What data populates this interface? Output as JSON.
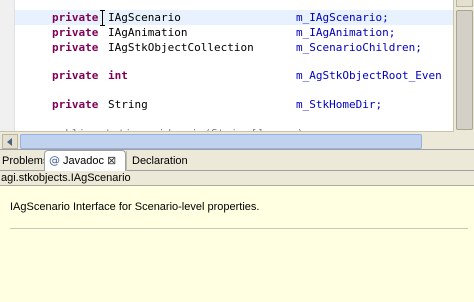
{
  "editor": {
    "lines": [
      {
        "keyword": "private",
        "type": "IAgScenario",
        "field": "m_IAgScenario;"
      },
      {
        "keyword": "private",
        "type": "IAgAnimation",
        "field": "m_IAgAnimation;"
      },
      {
        "keyword": "private",
        "type": "IAgStkObjectCollection",
        "field": "m_ScenarioChildren;"
      },
      {
        "keyword": "private",
        "type": "int",
        "field": "m_AgStkObjectRoot_Even"
      },
      {
        "keyword": "private",
        "type": "String",
        "field": "m_StkHomeDir;"
      }
    ],
    "partial_line": "public static void main(String[] args)"
  },
  "tabs": {
    "problems": "Problems",
    "javadoc": "Javadoc",
    "declaration": "Declaration"
  },
  "javadoc": {
    "title": "agi.stkobjects.IAgScenario",
    "description": "IAgScenario Interface for Scenario-level properties."
  },
  "colors": {
    "keyword": "#7f0055",
    "field": "#0000c0",
    "javadoc_bg": "#ffffe1"
  }
}
